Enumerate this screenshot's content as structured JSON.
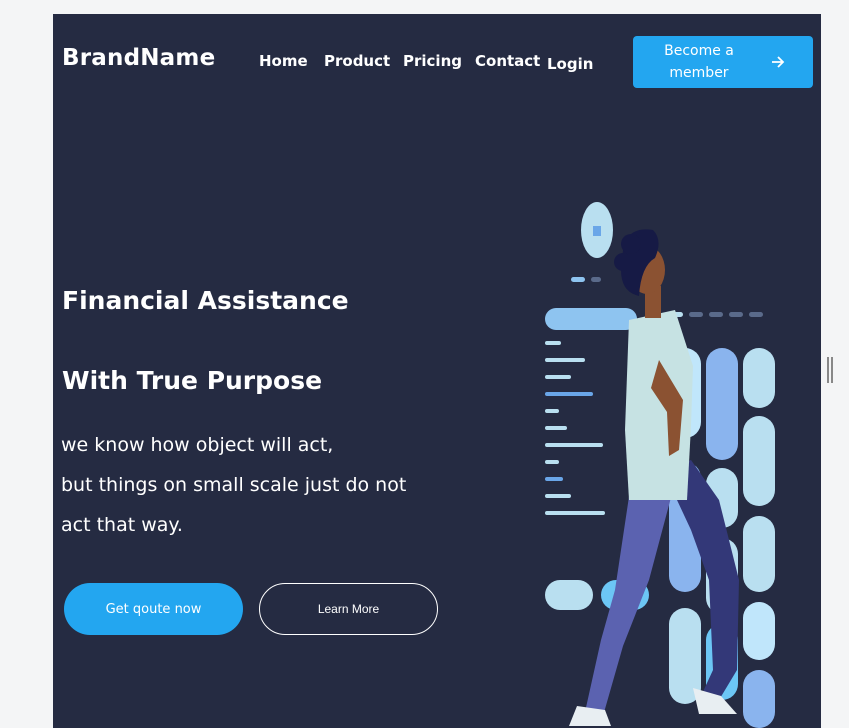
{
  "header": {
    "brand": "BrandName",
    "nav": [
      {
        "label": "Home"
      },
      {
        "label": "Product"
      },
      {
        "label": "Pricing"
      },
      {
        "label": "Contact"
      }
    ],
    "login_label": "Login",
    "cta_label": "Become a member",
    "cta_icon": "arrow-right-icon"
  },
  "hero": {
    "title_line1": "Financial Assistance",
    "title_line2": "With True Purpose",
    "desc_line1": "we know how object will act,",
    "desc_line2": "but things on small scale just do not",
    "desc_line3": "act that way.",
    "primary_button": "Get qoute now",
    "secondary_button": "Learn More"
  },
  "colors": {
    "background": "#252b42",
    "accent": "#23a6f0",
    "page": "#f4f5f6"
  }
}
